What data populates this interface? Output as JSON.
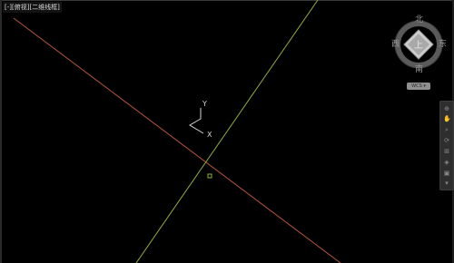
{
  "viewport": {
    "label": "[-][俯视][二维线框]"
  },
  "ucs": {
    "x_label": "X",
    "y_label": "Y"
  },
  "viewcube": {
    "north": "北",
    "south": "南",
    "east": "东",
    "west": "西",
    "face": "上",
    "wcs_tag": "WCS ▾"
  },
  "navbar": {
    "buttons": [
      "⊕",
      "✋",
      "⌕",
      "⟳",
      "⊞",
      "◈",
      "▣",
      "▾"
    ]
  },
  "colors": {
    "background": "#000000",
    "red_axis": "#b5563e",
    "green_axis": "#8fae3e",
    "ucs_icon": "#d6d6d6"
  }
}
